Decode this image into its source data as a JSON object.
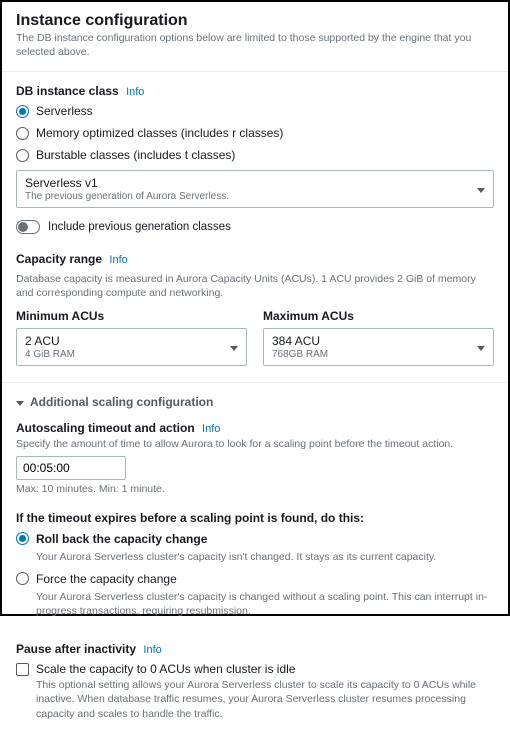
{
  "header": {
    "title": "Instance configuration",
    "subtitle": "The DB instance configuration options below are limited to those supported by the engine that you selected above."
  },
  "info_label": "Info",
  "db_class": {
    "label": "DB instance class",
    "options": {
      "serverless": "Serverless",
      "memory": "Memory optimized classes (includes r classes)",
      "burstable": "Burstable classes (includes t classes)"
    }
  },
  "version_select": {
    "primary": "Serverless v1",
    "secondary": "The previous generation of Aurora Serverless."
  },
  "prev_gen_toggle": "Include previous generation classes",
  "capacity": {
    "label": "Capacity range",
    "desc": "Database capacity is measured in Aurora Capacity Units (ACUs). 1 ACU provides 2 GiB of memory and corresponding compute and networking.",
    "min_label": "Minimum ACUs",
    "min_primary": "2 ACU",
    "min_secondary": "4 GiB RAM",
    "max_label": "Maximum ACUs",
    "max_primary": "384 ACU",
    "max_secondary": "768GB RAM"
  },
  "expander_label": "Additional scaling configuration",
  "autoscale": {
    "label": "Autoscaling timeout and action",
    "desc": "Specify the amount of time to allow Aurora to look for a scaling point before the timeout action.",
    "value": "00:05:00",
    "hint": "Max: 10 minutes. Min: 1 minute."
  },
  "timeout": {
    "heading": "If the timeout expires before a scaling point is found, do this:",
    "rollback_label": "Roll back the capacity change",
    "rollback_desc": "Your Aurora Serverless cluster's capacity isn't changed. It stays as its current capacity.",
    "force_label": "Force the capacity change",
    "force_desc": "Your Aurora Serverless cluster's capacity is changed without a scaling point. This can interrupt in-progress transactions, requiring resubmission."
  },
  "pause": {
    "label": "Pause after inactivity",
    "checkbox_label": "Scale the capacity to 0 ACUs when cluster is idle",
    "checkbox_desc": "This optional setting allows your Aurora Serverless cluster to scale its capacity to 0 ACUs while inactive. When database traffic resumes, your Aurora Serverless cluster resumes processing capacity and scales to handle the traffic."
  }
}
